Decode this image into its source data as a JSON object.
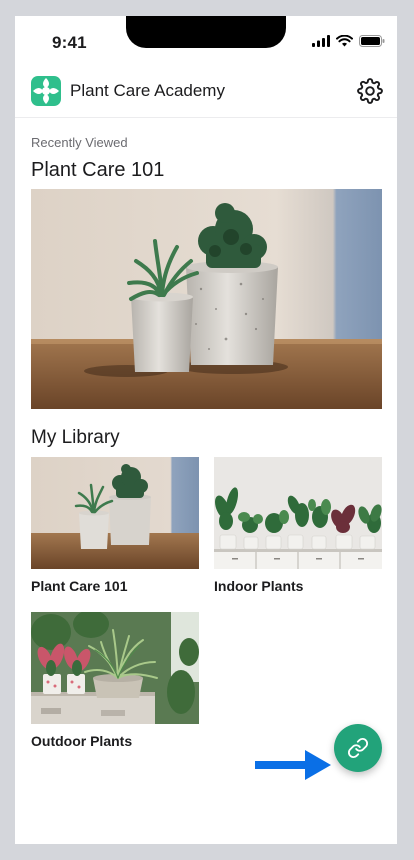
{
  "status": {
    "time": "9:41"
  },
  "header": {
    "title": "Plant Care Academy"
  },
  "recent": {
    "label": "Recently Viewed",
    "title": "Plant Care 101"
  },
  "library": {
    "title": "My Library",
    "items": [
      {
        "label": "Plant Care 101"
      },
      {
        "label": "Indoor Plants"
      },
      {
        "label": "Outdoor Plants"
      }
    ]
  },
  "colors": {
    "accent": "#22a37a",
    "arrow": "#0a6fe6"
  },
  "icons": {
    "logo": "plant-logo-icon",
    "settings": "gear-icon",
    "fab": "link-icon",
    "annotation": "arrow-right-icon"
  }
}
